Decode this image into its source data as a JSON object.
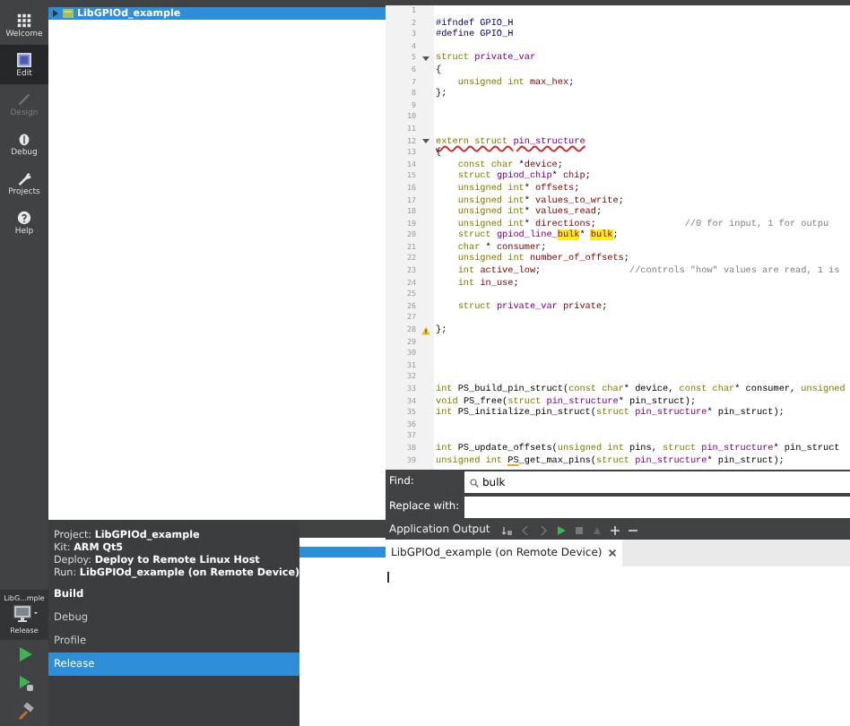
{
  "mode_bar": {
    "modes": [
      {
        "label": "Welcome",
        "selected": false,
        "disabled": false
      },
      {
        "label": "Edit",
        "selected": true,
        "disabled": false
      },
      {
        "label": "Design",
        "selected": false,
        "disabled": true
      },
      {
        "label": "Debug",
        "selected": false,
        "disabled": false
      },
      {
        "label": "Projects",
        "selected": false,
        "disabled": false
      },
      {
        "label": "Help",
        "selected": false,
        "disabled": false
      }
    ],
    "target": {
      "project": "LibG...mple",
      "config": "Release"
    }
  },
  "project_tree": {
    "items": [
      {
        "label": "LibGPIOd_example",
        "selected": true,
        "expanded": false
      }
    ]
  },
  "editor": {
    "lines": [
      {
        "number": "1",
        "fold": false,
        "warning": false
      },
      {
        "number": "2",
        "fold": false,
        "warning": false,
        "segments": [
          {
            "text": "#ifndef GPIO_H",
            "kind": "pre"
          }
        ]
      },
      {
        "number": "3",
        "fold": false,
        "warning": false,
        "segments": [
          {
            "text": "#define GPIO_H",
            "kind": "pre"
          }
        ]
      },
      {
        "number": "4",
        "fold": false,
        "warning": false
      },
      {
        "number": "5",
        "fold": true,
        "warning": false,
        "segments": [
          {
            "text": "struct ",
            "kind": "kw"
          },
          {
            "text": "private_var",
            "kind": "type"
          }
        ]
      },
      {
        "number": "6",
        "fold": false,
        "warning": false,
        "segments": [
          {
            "text": "{",
            "kind": "plain"
          }
        ]
      },
      {
        "number": "7",
        "fold": false,
        "warning": false,
        "segments": [
          {
            "text": "    unsigned int ",
            "kind": "kw"
          },
          {
            "text": "max_hex",
            "kind": "field"
          },
          {
            "text": ";",
            "kind": "plain"
          }
        ]
      },
      {
        "number": "8",
        "fold": false,
        "warning": false,
        "segments": [
          {
            "text": "};",
            "kind": "plain"
          }
        ]
      },
      {
        "number": "9",
        "fold": false,
        "warning": false
      },
      {
        "number": "10",
        "fold": false,
        "warning": false
      },
      {
        "number": "11",
        "fold": false,
        "warning": false
      },
      {
        "number": "12",
        "fold": true,
        "warning": false,
        "segments": [
          {
            "text": "extern struct ",
            "kind": "kw",
            "error": true
          },
          {
            "text": "pin_structure",
            "kind": "type",
            "error": true
          }
        ]
      },
      {
        "number": "13",
        "fold": false,
        "warning": false,
        "segments": [
          {
            "text": "{",
            "kind": "plain"
          }
        ]
      },
      {
        "number": "14",
        "fold": false,
        "warning": false,
        "segments": [
          {
            "text": "    const char",
            "kind": "kw"
          },
          {
            "text": " *",
            "kind": "plain"
          },
          {
            "text": "device",
            "kind": "field"
          },
          {
            "text": ";",
            "kind": "plain"
          }
        ]
      },
      {
        "number": "15",
        "fold": false,
        "warning": false,
        "segments": [
          {
            "text": "    struct ",
            "kind": "kw"
          },
          {
            "text": "gpiod_chip",
            "kind": "type"
          },
          {
            "text": "* ",
            "kind": "plain"
          },
          {
            "text": "chip",
            "kind": "field"
          },
          {
            "text": ";",
            "kind": "plain"
          }
        ]
      },
      {
        "number": "16",
        "fold": false,
        "warning": false,
        "segments": [
          {
            "text": "    unsigned int",
            "kind": "kw"
          },
          {
            "text": "* ",
            "kind": "plain"
          },
          {
            "text": "offsets",
            "kind": "field"
          },
          {
            "text": ";",
            "kind": "plain"
          }
        ]
      },
      {
        "number": "17",
        "fold": false,
        "warning": false,
        "segments": [
          {
            "text": "    unsigned int",
            "kind": "kw"
          },
          {
            "text": "* ",
            "kind": "plain"
          },
          {
            "text": "values_to_write",
            "kind": "field"
          },
          {
            "text": ";",
            "kind": "plain"
          }
        ]
      },
      {
        "number": "18",
        "fold": false,
        "warning": false,
        "segments": [
          {
            "text": "    unsigned int",
            "kind": "kw"
          },
          {
            "text": "* ",
            "kind": "plain"
          },
          {
            "text": "values_read",
            "kind": "field"
          },
          {
            "text": ";",
            "kind": "plain"
          }
        ]
      },
      {
        "number": "19",
        "fold": false,
        "warning": false,
        "segments": [
          {
            "text": "    unsigned int",
            "kind": "kw"
          },
          {
            "text": "* ",
            "kind": "plain"
          },
          {
            "text": "directions",
            "kind": "field"
          },
          {
            "text": ";                ",
            "kind": "plain"
          },
          {
            "text": "//0 for input, 1 for outpu",
            "kind": "comment"
          }
        ]
      },
      {
        "number": "20",
        "fold": false,
        "warning": false,
        "segments": [
          {
            "text": "    struct ",
            "kind": "kw"
          },
          {
            "text": "gpiod_line_",
            "kind": "type"
          },
          {
            "text": "bulk",
            "kind": "match"
          },
          {
            "text": "* ",
            "kind": "plain"
          },
          {
            "text": "bulk",
            "kind": "match"
          },
          {
            "text": ";",
            "kind": "plain"
          }
        ]
      },
      {
        "number": "21",
        "fold": false,
        "warning": false,
        "segments": [
          {
            "text": "    char",
            "kind": "kw"
          },
          {
            "text": " * ",
            "kind": "plain"
          },
          {
            "text": "consumer",
            "kind": "field"
          },
          {
            "text": ";",
            "kind": "plain"
          }
        ]
      },
      {
        "number": "22",
        "fold": false,
        "warning": false,
        "segments": [
          {
            "text": "    unsigned int ",
            "kind": "kw"
          },
          {
            "text": "number_of_offsets",
            "kind": "field"
          },
          {
            "text": ";",
            "kind": "plain"
          }
        ]
      },
      {
        "number": "23",
        "fold": false,
        "warning": false,
        "segments": [
          {
            "text": "    int ",
            "kind": "kw"
          },
          {
            "text": "active_low",
            "kind": "field"
          },
          {
            "text": ";                ",
            "kind": "plain"
          },
          {
            "text": "//controls \"how\" values are read, 1 is",
            "kind": "comment"
          }
        ]
      },
      {
        "number": "24",
        "fold": false,
        "warning": false,
        "segments": [
          {
            "text": "    int ",
            "kind": "kw"
          },
          {
            "text": "in_use",
            "kind": "field"
          },
          {
            "text": ";",
            "kind": "plain"
          }
        ]
      },
      {
        "number": "25",
        "fold": false,
        "warning": false
      },
      {
        "number": "26",
        "fold": false,
        "warning": false,
        "segments": [
          {
            "text": "    struct ",
            "kind": "kw"
          },
          {
            "text": "private_var ",
            "kind": "type"
          },
          {
            "text": "private",
            "kind": "field"
          },
          {
            "text": ";",
            "kind": "plain"
          }
        ]
      },
      {
        "number": "27",
        "fold": false,
        "warning": false
      },
      {
        "number": "28",
        "fold": false,
        "warning": true,
        "segments": [
          {
            "text": "};",
            "kind": "plain"
          }
        ]
      },
      {
        "number": "29",
        "fold": false,
        "warning": false
      },
      {
        "number": "30",
        "fold": false,
        "warning": false
      },
      {
        "number": "31",
        "fold": false,
        "warning": false
      },
      {
        "number": "32",
        "fold": false,
        "warning": false
      },
      {
        "number": "33",
        "fold": false,
        "warning": false,
        "segments": [
          {
            "text": "int ",
            "kind": "kw"
          },
          {
            "text": "PS_build_pin_struct",
            "kind": "func"
          },
          {
            "text": "(",
            "kind": "plain"
          },
          {
            "text": "const char",
            "kind": "kw"
          },
          {
            "text": "* device, ",
            "kind": "plain"
          },
          {
            "text": "const char",
            "kind": "kw"
          },
          {
            "text": "* consumer, ",
            "kind": "plain"
          },
          {
            "text": "unsigned",
            "kind": "kw"
          }
        ]
      },
      {
        "number": "34",
        "fold": false,
        "warning": false,
        "segments": [
          {
            "text": "void ",
            "kind": "kw"
          },
          {
            "text": "PS_free",
            "kind": "func"
          },
          {
            "text": "(",
            "kind": "plain"
          },
          {
            "text": "struct ",
            "kind": "kw"
          },
          {
            "text": "pin_structure",
            "kind": "type"
          },
          {
            "text": "* pin_struct);",
            "kind": "plain"
          }
        ]
      },
      {
        "number": "35",
        "fold": false,
        "warning": false,
        "segments": [
          {
            "text": "int ",
            "kind": "kw"
          },
          {
            "text": "PS_initialize_pin_struct",
            "kind": "func"
          },
          {
            "text": "(",
            "kind": "plain"
          },
          {
            "text": "struct ",
            "kind": "kw"
          },
          {
            "text": "pin_structure",
            "kind": "type"
          },
          {
            "text": "* pin_struct);",
            "kind": "plain"
          }
        ]
      },
      {
        "number": "36",
        "fold": false,
        "warning": false
      },
      {
        "number": "37",
        "fold": false,
        "warning": false
      },
      {
        "number": "38",
        "fold": false,
        "warning": false,
        "segments": [
          {
            "text": "int ",
            "kind": "kw"
          },
          {
            "text": "PS_update_offsets",
            "kind": "func"
          },
          {
            "text": "(",
            "kind": "plain"
          },
          {
            "text": "unsigned int",
            "kind": "kw"
          },
          {
            "text": " pins, ",
            "kind": "plain"
          },
          {
            "text": "struct ",
            "kind": "kw"
          },
          {
            "text": "pin_structure",
            "kind": "type"
          },
          {
            "text": "* pin_struct",
            "kind": "plain"
          }
        ]
      },
      {
        "number": "39",
        "fold": false,
        "warning": false,
        "segments": [
          {
            "text": "unsigned int ",
            "kind": "kw"
          },
          {
            "text": "PS",
            "kind": "func",
            "warning": true
          },
          {
            "text": "_get_max_pins",
            "kind": "func"
          },
          {
            "text": "(",
            "kind": "plain"
          },
          {
            "text": "struct ",
            "kind": "kw"
          },
          {
            "text": "pin_structure",
            "kind": "type"
          },
          {
            "text": "* pin_struct);",
            "kind": "plain"
          }
        ]
      }
    ]
  },
  "find_bar": {
    "find_label": "Find:",
    "find_value": "bulk",
    "replace_label": "Replace with:"
  },
  "output_pane": {
    "title": "Application Output",
    "tabs": [
      {
        "label": "LibGPIOd_example (on Remote Device)",
        "selected": true
      }
    ]
  },
  "kit_popup": {
    "details": [
      {
        "label": "Project:",
        "value": "LibGPIOd_example"
      },
      {
        "label": "Kit:",
        "value": "ARM Qt5"
      },
      {
        "label": "Deploy:",
        "value": "Deploy to Remote Linux Host"
      },
      {
        "label": "Run:",
        "value": "LibGPIOd_example (on Remote Device)"
      }
    ],
    "section": "Build",
    "items": [
      {
        "label": "Debug",
        "selected": false
      },
      {
        "label": "Profile",
        "selected": false
      },
      {
        "label": "Release",
        "selected": true
      }
    ]
  },
  "side_list": {
    "rows": [
      {
        "selected": true
      }
    ]
  }
}
